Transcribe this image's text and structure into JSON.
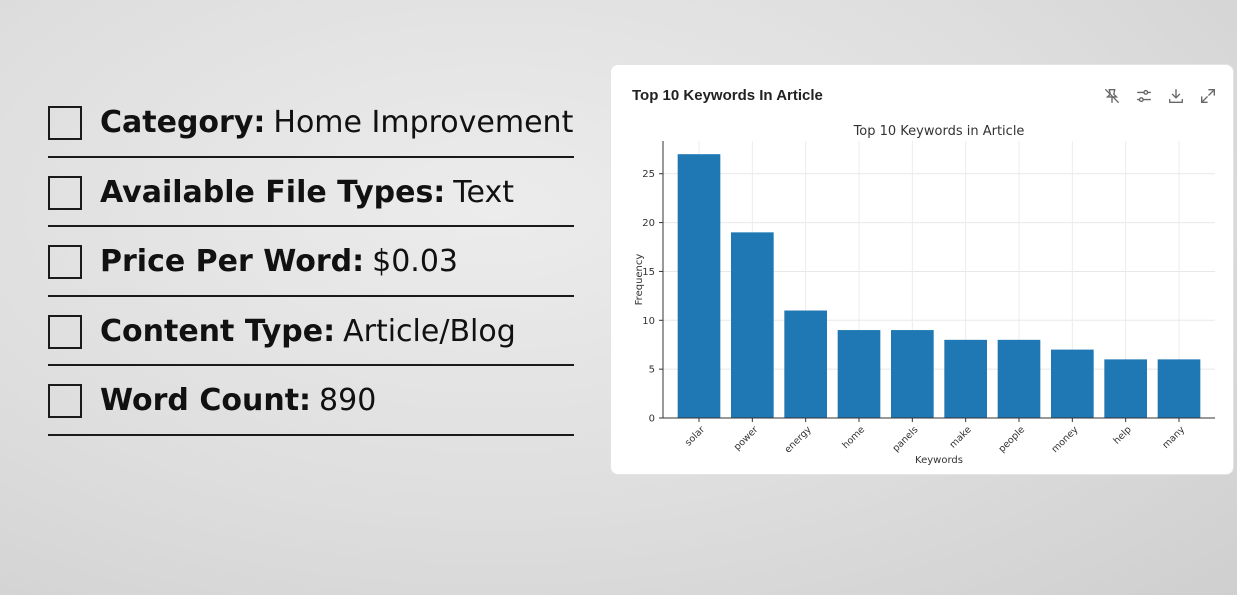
{
  "checklist": [
    {
      "label": "Category:",
      "value": "Home Improvement"
    },
    {
      "label": "Available File Types:",
      "value": "Text"
    },
    {
      "label": "Price Per Word:",
      "value": "$0.03"
    },
    {
      "label": "Content Type:",
      "value": "Article/Blog"
    },
    {
      "label": "Word Count:",
      "value": "890"
    }
  ],
  "card": {
    "title": "Top 10 Keywords In Article",
    "tools": [
      "pin-off-icon",
      "sliders-icon",
      "download-icon",
      "expand-icon"
    ]
  },
  "colors": {
    "bar": "#1f77b4",
    "text": "#111111"
  },
  "chart_data": {
    "type": "bar",
    "title": "Top 10 Keywords in Article",
    "xlabel": "Keywords",
    "ylabel": "Frequency",
    "categories": [
      "solar",
      "power",
      "energy",
      "home",
      "panels",
      "make",
      "people",
      "money",
      "help",
      "many"
    ],
    "values": [
      27,
      19,
      11,
      9,
      9,
      8,
      8,
      7,
      6,
      6
    ],
    "ylim": [
      0,
      28.35
    ],
    "yticks": [
      0,
      5,
      10,
      15,
      20,
      25
    ],
    "grid": true,
    "legend": "none"
  }
}
